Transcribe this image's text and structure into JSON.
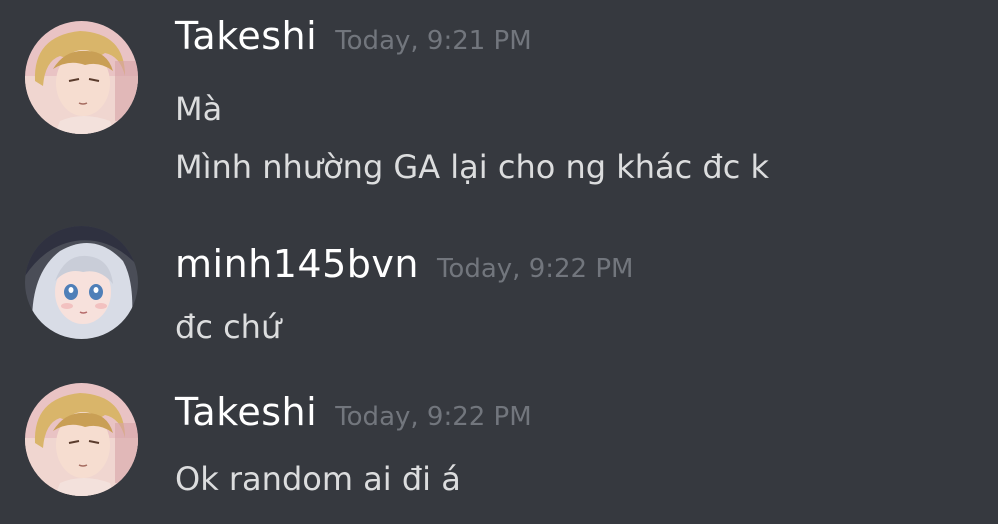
{
  "messages": [
    {
      "username": "Takeshi",
      "timestamp": "Today, 9:21 PM",
      "avatar_icon": "blond-anime-boy-avatar",
      "lines": [
        "Mà",
        "Mình nhường GA lại cho ng khác đc k"
      ]
    },
    {
      "username": "minh145bvn",
      "timestamp": "Today, 9:22 PM",
      "avatar_icon": "white-haired-anime-girl-avatar",
      "lines": [
        "đc chứ"
      ]
    },
    {
      "username": "Takeshi",
      "timestamp": "Today, 9:22 PM",
      "avatar_icon": "blond-anime-boy-avatar",
      "lines": [
        "Ok random ai đi á"
      ]
    }
  ],
  "colors": {
    "background": "#36393f",
    "username": "#ffffff",
    "timestamp": "#72767d",
    "text": "#dcddde"
  }
}
